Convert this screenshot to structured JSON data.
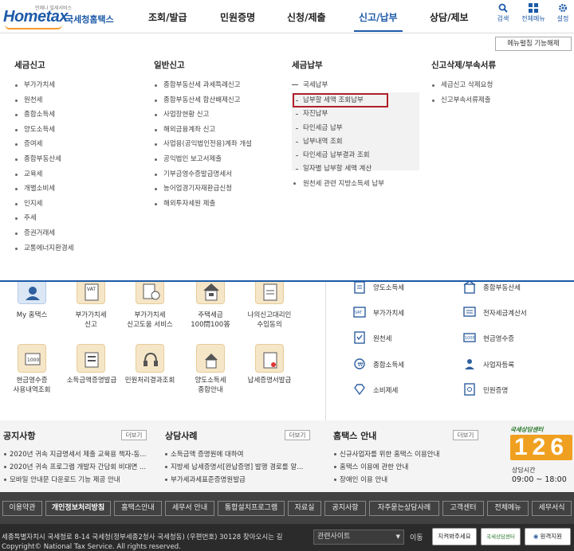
{
  "header": {
    "logo_sub": "언제나 빌세서비스",
    "logo_main": "Hometax",
    "logo_kr": "국세청홈택스",
    "nav": [
      "조회/발급",
      "민원증명",
      "신청/제출",
      "신고/납부",
      "상담/제보"
    ],
    "active_nav": "신고/납부",
    "utils": [
      {
        "label": "검색",
        "icon": "search-icon"
      },
      {
        "label": "전체메뉴",
        "icon": "grid-menu-icon"
      },
      {
        "label": "설정",
        "icon": "gear-icon"
      }
    ]
  },
  "mega": {
    "menu_setting": "메뉴펼침 기능해제",
    "col1": {
      "title": "세금신고",
      "items": [
        "부가가치세",
        "원천세",
        "종합소득세",
        "양도소득세",
        "증여세",
        "종합부동산세",
        "교육세",
        "개별소비세",
        "인지세",
        "주세",
        "증권거래세",
        "교통에너지환경세"
      ]
    },
    "col2": {
      "title": "일반신고",
      "items": [
        "종합부동산세 과세특례신고",
        "종합부동산세 합산배제신고",
        "사업장현황 신고",
        "해외금융계좌 신고",
        "사업용(공익법인전용)계좌 개설",
        "공익법인 보고서제출",
        "기부금영수증발급명세서",
        "농어업경기자재환급신청",
        "해외투자세원 제출"
      ]
    },
    "col3": {
      "title": "세금납부",
      "sub_title": "국세납부",
      "sub_items": [
        "납부할 세액 조회납부",
        "자진납부",
        "타인세금 납부",
        "납부내역 조회",
        "타인세금 납부결과 조회",
        "일자별 납부할 세액 계산"
      ],
      "extra": "원천세 관련 지방소득세 납부"
    },
    "col4": {
      "title": "신고삭제/부속서류",
      "items": [
        "세금신고 삭제요청",
        "신고부속서류제출"
      ]
    }
  },
  "quick": {
    "icons": [
      {
        "label": "My 홈택스",
        "icon": "person-icon"
      },
      {
        "label": "부가가치세\n신고",
        "icon": "vat-doc-icon"
      },
      {
        "label": "부가가치세\n신고도움 서비스",
        "icon": "vat-help-icon"
      },
      {
        "label": "주택세금\n100問100答",
        "icon": "house-icon"
      },
      {
        "label": "나의신고대리인\n수임동의",
        "icon": "agent-icon"
      },
      {
        "label": "현금영수증\n사용내역조회",
        "icon": "receipt-icon"
      },
      {
        "label": "소득금액증명발급",
        "icon": "income-cert-icon"
      },
      {
        "label": "민원처리결과조회",
        "icon": "headset-icon"
      },
      {
        "label": "양도소득세\n종합안내",
        "icon": "transfer-tax-icon"
      },
      {
        "label": "납세증명서발급",
        "icon": "tax-cert-icon"
      }
    ],
    "services_left": [
      {
        "label": "양도소득세",
        "icon": "doc-icon"
      },
      {
        "label": "부가가치세",
        "icon": "vat-icon"
      },
      {
        "label": "원천세",
        "icon": "withhold-icon"
      },
      {
        "label": "종합소득세",
        "icon": "coin-icon"
      },
      {
        "label": "소비제세",
        "icon": "diamond-icon"
      }
    ],
    "services_right": [
      {
        "label": "종합부동산세",
        "icon": "building-icon"
      },
      {
        "label": "전자세금계산서",
        "icon": "invoice-icon"
      },
      {
        "label": "현금영수증",
        "icon": "cash-receipt-icon"
      },
      {
        "label": "사업자등록",
        "icon": "register-icon"
      },
      {
        "label": "민원증명",
        "icon": "cert-icon"
      }
    ]
  },
  "notices": {
    "more": "더보기",
    "board1": {
      "title": "공지사항",
      "items": [
        "2020년 귀속 지급명세서 제출 교육용 책자-동...",
        "2020년 귀속 프로그램 개발자 간담회 비대면 ...",
        "모바일 안내문 다운로드 기능 제공 안내"
      ]
    },
    "board2": {
      "title": "상담사례",
      "items": [
        "소득금액 증명원에 대하여",
        "지방세 납세증명서[완납증명] 발행 경로를 알...",
        "부가세과세표준증명원발급"
      ]
    },
    "board3": {
      "title": "홈택스 안내",
      "items": [
        "신규사업자를 위한 홈택스 이용안내",
        "홈택스 이용에 관한 안내",
        "장애인 이용 안내"
      ]
    },
    "center": {
      "top": "국세상담센터",
      "number": "126",
      "hours_label": "상담시간",
      "hours": "09:00 ~ 18:00"
    }
  },
  "footer": {
    "links": [
      "이용약관",
      "개인정보처리방침",
      "홈택스안내",
      "세무서 안내",
      "통합설치프로그램",
      "자료실",
      "공지사항",
      "자주묻는상담사례",
      "고객센터",
      "전체메뉴",
      "세무서식"
    ],
    "bold_link": "개인정보처리방침",
    "address": "세종특별자치시 국세청로 8-14 국세청(정부세종2청사 국세청동) (우편번호) 30128  찾아오시는 길",
    "copyright": "Copyright© National Tax Service. All rights reserved.",
    "select_label": "관련사이트",
    "go": "이동",
    "btn1": "지켜봐주세요",
    "btn2": "국세상담센터",
    "btn3": "원격지원"
  }
}
